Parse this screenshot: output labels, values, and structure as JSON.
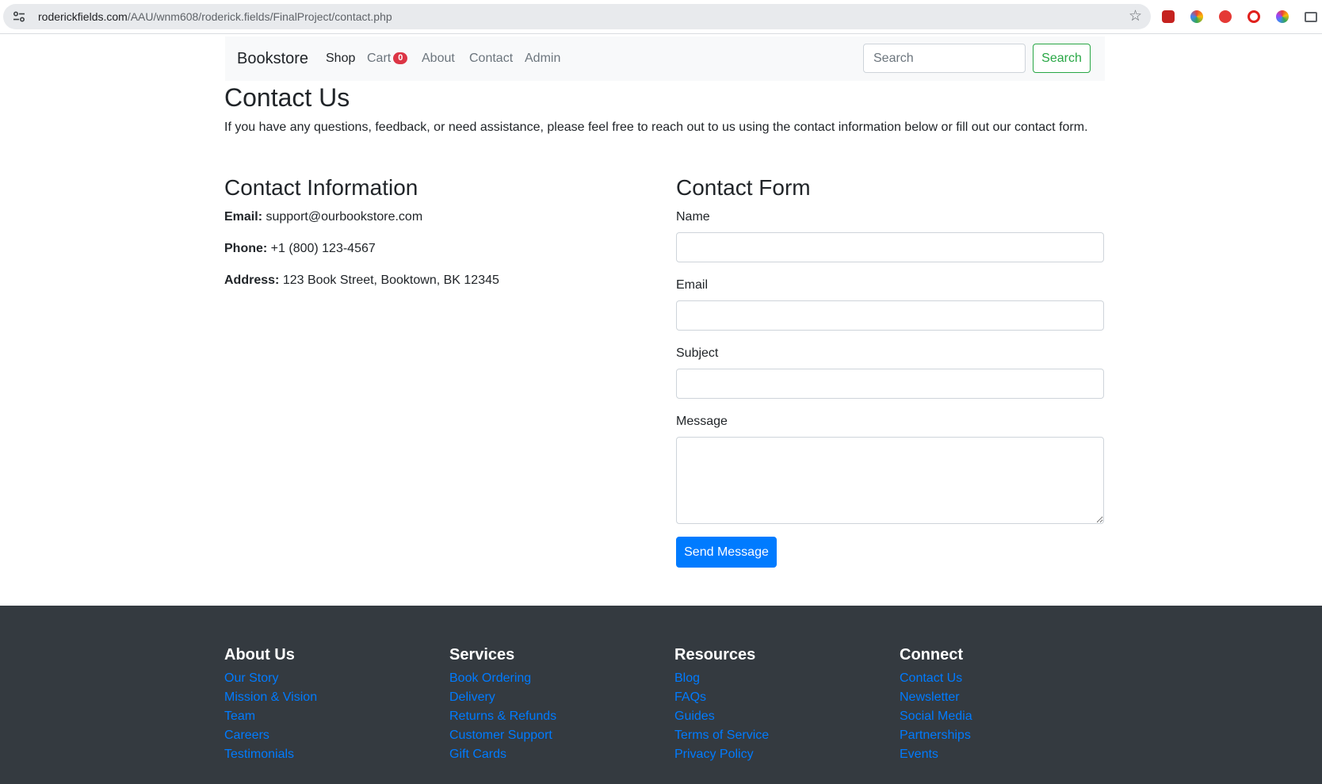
{
  "browser": {
    "url_host": "roderickfields.com",
    "url_path": "/AAU/wnm608/roderick.fields/FinalProject/contact.php",
    "icons": [
      "tune-icon",
      "bookmark-star-icon",
      "extension-icons"
    ]
  },
  "navbar": {
    "brand": "Bookstore",
    "links": [
      {
        "label": "Shop",
        "active": true
      },
      {
        "label": "Cart",
        "badge": "0"
      },
      {
        "label": "About"
      },
      {
        "label": "Contact"
      },
      {
        "label": "Admin"
      }
    ],
    "search_placeholder": "Search",
    "search_button": "Search"
  },
  "page": {
    "title": "Contact Us",
    "intro": "If you have any questions, feedback, or need assistance, please feel free to reach out to us using the contact information below or fill out our contact form."
  },
  "contact_info": {
    "heading": "Contact Information",
    "email_label": "Email:",
    "email": "support@ourbookstore.com",
    "phone_label": "Phone:",
    "phone": "+1 (800) 123-4567",
    "address_label": "Address:",
    "address": "123 Book Street, Booktown, BK 12345"
  },
  "contact_form": {
    "heading": "Contact Form",
    "name_label": "Name",
    "email_label": "Email",
    "subject_label": "Subject",
    "message_label": "Message",
    "submit": "Send Message"
  },
  "footer": {
    "columns": [
      {
        "heading": "About Us",
        "links": [
          "Our Story",
          "Mission & Vision",
          "Team",
          "Careers",
          "Testimonials"
        ]
      },
      {
        "heading": "Services",
        "links": [
          "Book Ordering",
          "Delivery",
          "Returns & Refunds",
          "Customer Support",
          "Gift Cards"
        ]
      },
      {
        "heading": "Resources",
        "links": [
          "Blog",
          "FAQs",
          "Guides",
          "Terms of Service",
          "Privacy Policy"
        ]
      },
      {
        "heading": "Connect",
        "links": [
          "Contact Us",
          "Newsletter",
          "Social Media",
          "Partnerships",
          "Events"
        ]
      }
    ]
  },
  "colors": {
    "primary": "#007bff",
    "success": "#28a745",
    "danger": "#dc3545",
    "footer_bg": "#343a40"
  }
}
